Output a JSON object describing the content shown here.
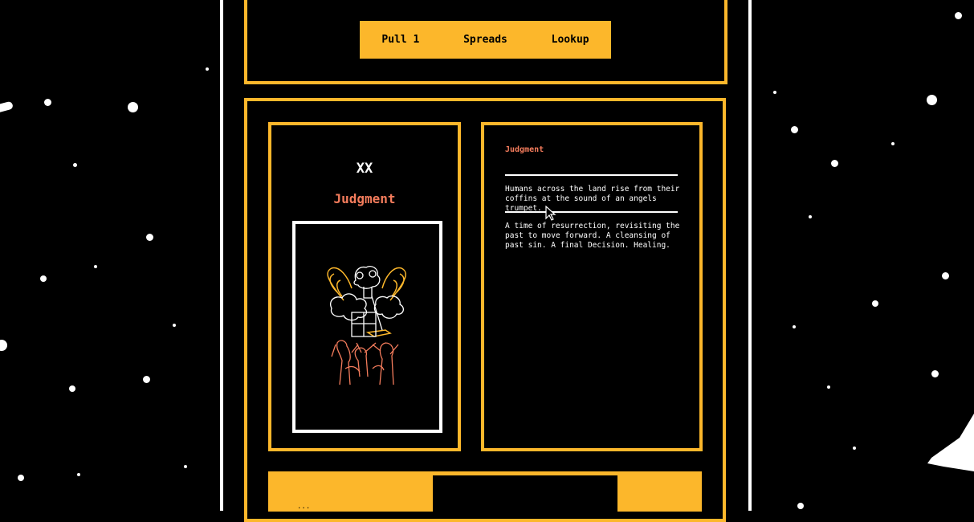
{
  "nav": {
    "items": [
      {
        "label": "Pull 1"
      },
      {
        "label": "Spreads"
      },
      {
        "label": "Lookup"
      }
    ]
  },
  "card": {
    "number": "XX",
    "name": "Judgment",
    "image_icon": "judgment-card-illustration"
  },
  "description": {
    "title": "Judgment",
    "imagery": "Humans across the land rise from their coffins at the sound of an angels trumpet.",
    "meaning": "A time of resurrection, revisiting the past to move forward. A cleansing of past sin. A final Decision. Healing."
  },
  "bottom": {
    "label": "..."
  },
  "colors": {
    "accent": "#fcb72b",
    "highlight": "#f47c5c",
    "background": "#000000",
    "text": "#ffffff"
  }
}
